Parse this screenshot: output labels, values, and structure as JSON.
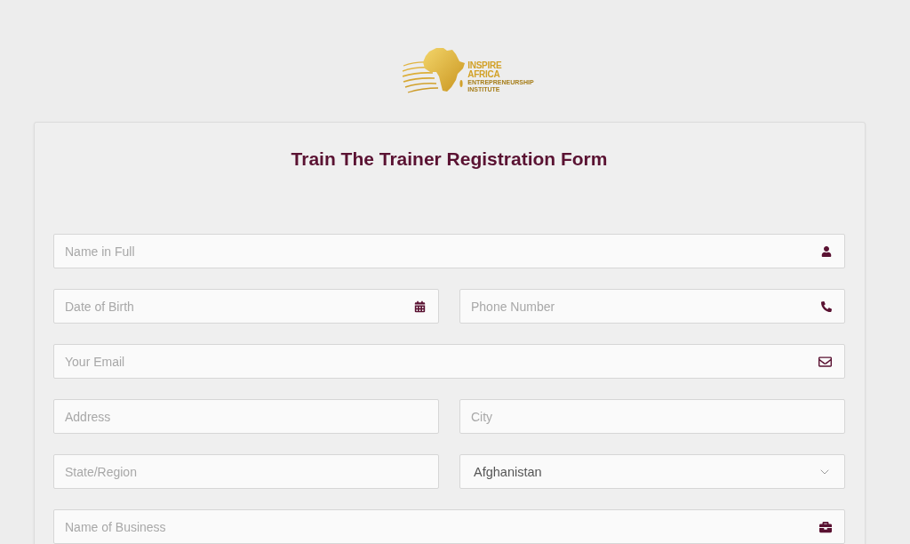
{
  "logo": {
    "name_lines": [
      "INSPIRE",
      "AFRICA"
    ],
    "tagline_lines": [
      "ENTREPRENEURSHIP",
      "INSTITUTE"
    ]
  },
  "form": {
    "title": "Train The Trainer Registration Form",
    "rows": [
      {
        "fields": [
          {
            "kind": "input",
            "placeholder": "Name in Full"
          }
        ]
      },
      {
        "fields": [
          {
            "kind": "input",
            "placeholder": "Date of Birth"
          },
          {
            "kind": "input",
            "placeholder": "Phone Number"
          }
        ]
      },
      {
        "fields": [
          {
            "kind": "input",
            "placeholder": "Your Email"
          }
        ]
      },
      {
        "fields": [
          {
            "kind": "input",
            "placeholder": "Address"
          },
          {
            "kind": "input",
            "placeholder": "City"
          }
        ]
      },
      {
        "fields": [
          {
            "kind": "input",
            "placeholder": "State/Region"
          },
          {
            "kind": "select",
            "value": "Afghanistan"
          }
        ]
      },
      {
        "fields": [
          {
            "kind": "input",
            "placeholder": "Name of Business"
          }
        ]
      }
    ]
  }
}
